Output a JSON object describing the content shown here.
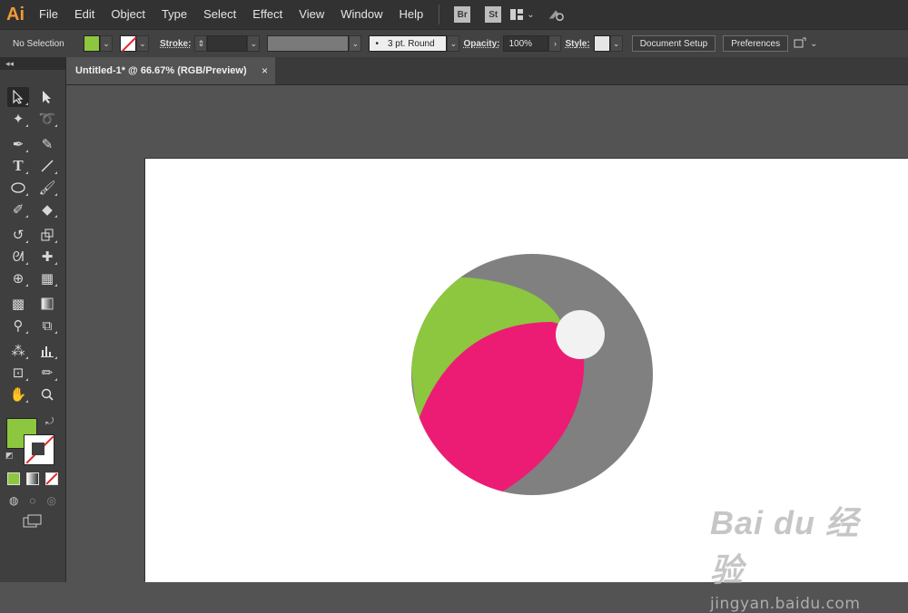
{
  "app": {
    "logo": "Ai"
  },
  "menu": [
    "File",
    "Edit",
    "Object",
    "Type",
    "Select",
    "Effect",
    "View",
    "Window",
    "Help"
  ],
  "bridge_badges": [
    "Br",
    "St"
  ],
  "controlbar": {
    "selection": "No Selection",
    "fill_color": "#8dc63f",
    "stroke_label": "Stroke:",
    "brush_value": "3 pt. Round",
    "opacity_label": "Opacity:",
    "opacity_value": "100%",
    "style_label": "Style:",
    "document_setup": "Document Setup",
    "preferences": "Preferences"
  },
  "document": {
    "tab_title": "Untitled-1* @ 66.67% (RGB/Preview)",
    "close_glyph": "×"
  },
  "toolbox": {
    "collapse_glyph": "◂◂"
  },
  "artwork": {
    "colors": {
      "gray": "#808080",
      "green": "#8dc63f",
      "pink": "#ec1c74",
      "white": "#f2f2f2"
    }
  },
  "watermark": {
    "logo": "Bai du 经验",
    "url": "jingyan.baidu.com"
  }
}
